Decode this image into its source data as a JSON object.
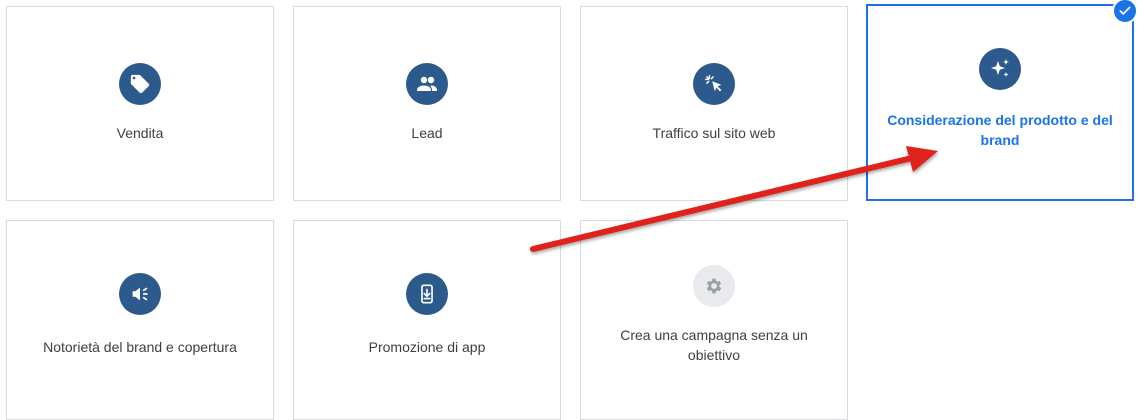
{
  "cards": [
    {
      "label": "Vendita",
      "icon": "tag-icon",
      "selected": false
    },
    {
      "label": "Lead",
      "icon": "people-icon",
      "selected": false
    },
    {
      "label": "Traffico sul sito web",
      "icon": "cursor-click-icon",
      "selected": false
    },
    {
      "label": "Considerazione del prodotto e del brand",
      "icon": "sparkle-icon",
      "selected": true
    },
    {
      "label": "Notorietà del brand e copertura",
      "icon": "speaker-icon",
      "selected": false
    },
    {
      "label": "Promozione di app",
      "icon": "phone-download-icon",
      "selected": false
    },
    {
      "label": "Crea una campagna senza un obiettivo",
      "icon": "gear-icon",
      "selected": false
    }
  ],
  "colors": {
    "icon_bg": "#2d5a8c",
    "icon_bg_disabled": "#e8eaed",
    "accent": "#1a73e8",
    "annotation_arrow": "#e0201c"
  }
}
